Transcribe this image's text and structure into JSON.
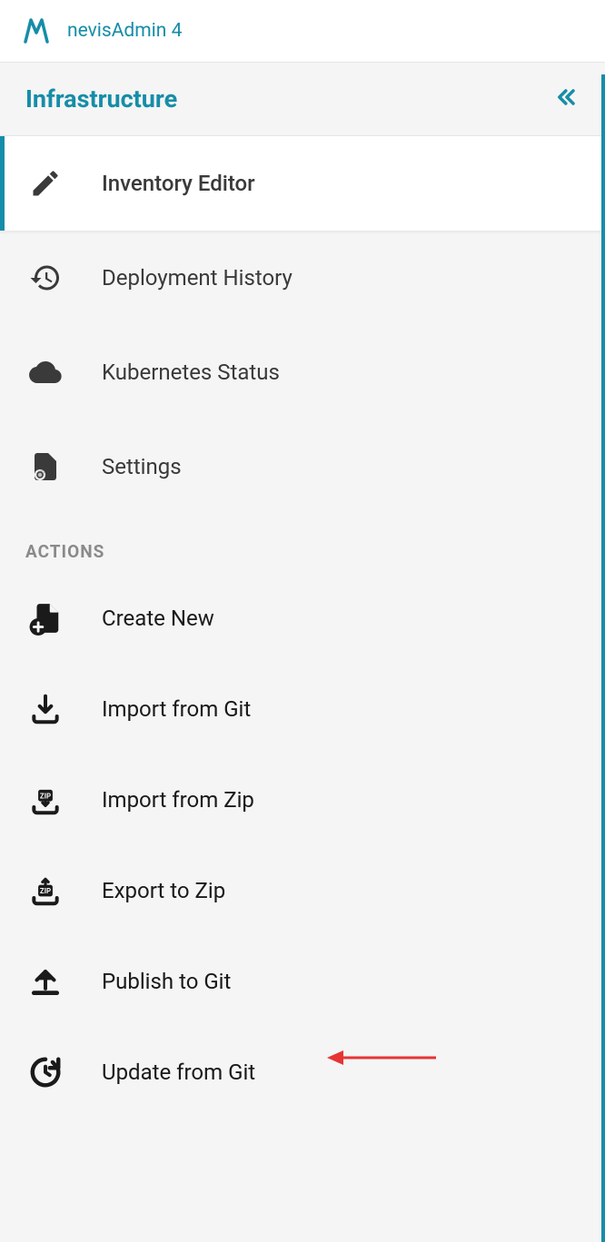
{
  "header": {
    "app_title": "nevisAdmin 4"
  },
  "sidebar": {
    "section_title": "Infrastructure",
    "nav_items": [
      {
        "label": "Inventory Editor",
        "icon": "edit-icon",
        "active": true
      },
      {
        "label": "Deployment History",
        "icon": "history-icon",
        "active": false
      },
      {
        "label": "Kubernetes Status",
        "icon": "cloud-icon",
        "active": false
      },
      {
        "label": "Settings",
        "icon": "file-gear-icon",
        "active": false
      }
    ],
    "actions_label": "ACTIONS",
    "actions": [
      {
        "label": "Create New",
        "icon": "file-plus-icon"
      },
      {
        "label": "Import from Git",
        "icon": "download-icon"
      },
      {
        "label": "Import from Zip",
        "icon": "zip-down-icon"
      },
      {
        "label": "Export to Zip",
        "icon": "zip-up-icon"
      },
      {
        "label": "Publish to Git",
        "icon": "upload-icon"
      },
      {
        "label": "Update from Git",
        "icon": "refresh-icon"
      }
    ]
  },
  "annotation": {
    "highlighted_action_index": 5
  }
}
